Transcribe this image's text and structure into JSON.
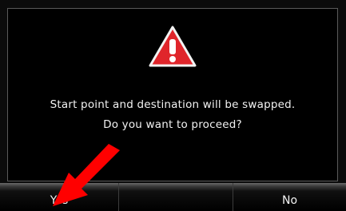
{
  "dialog": {
    "message_line_1": "Start point and destination will be swapped.",
    "message_line_2": "Do you want to proceed?",
    "icon": "warning-icon"
  },
  "buttons": {
    "yes_label": "Yes",
    "middle_label": "",
    "no_label": "No"
  },
  "colors": {
    "background": "#000000",
    "warning_red": "#e0252b",
    "text": "#f2f2f2",
    "annotation_arrow": "#ff0000"
  }
}
